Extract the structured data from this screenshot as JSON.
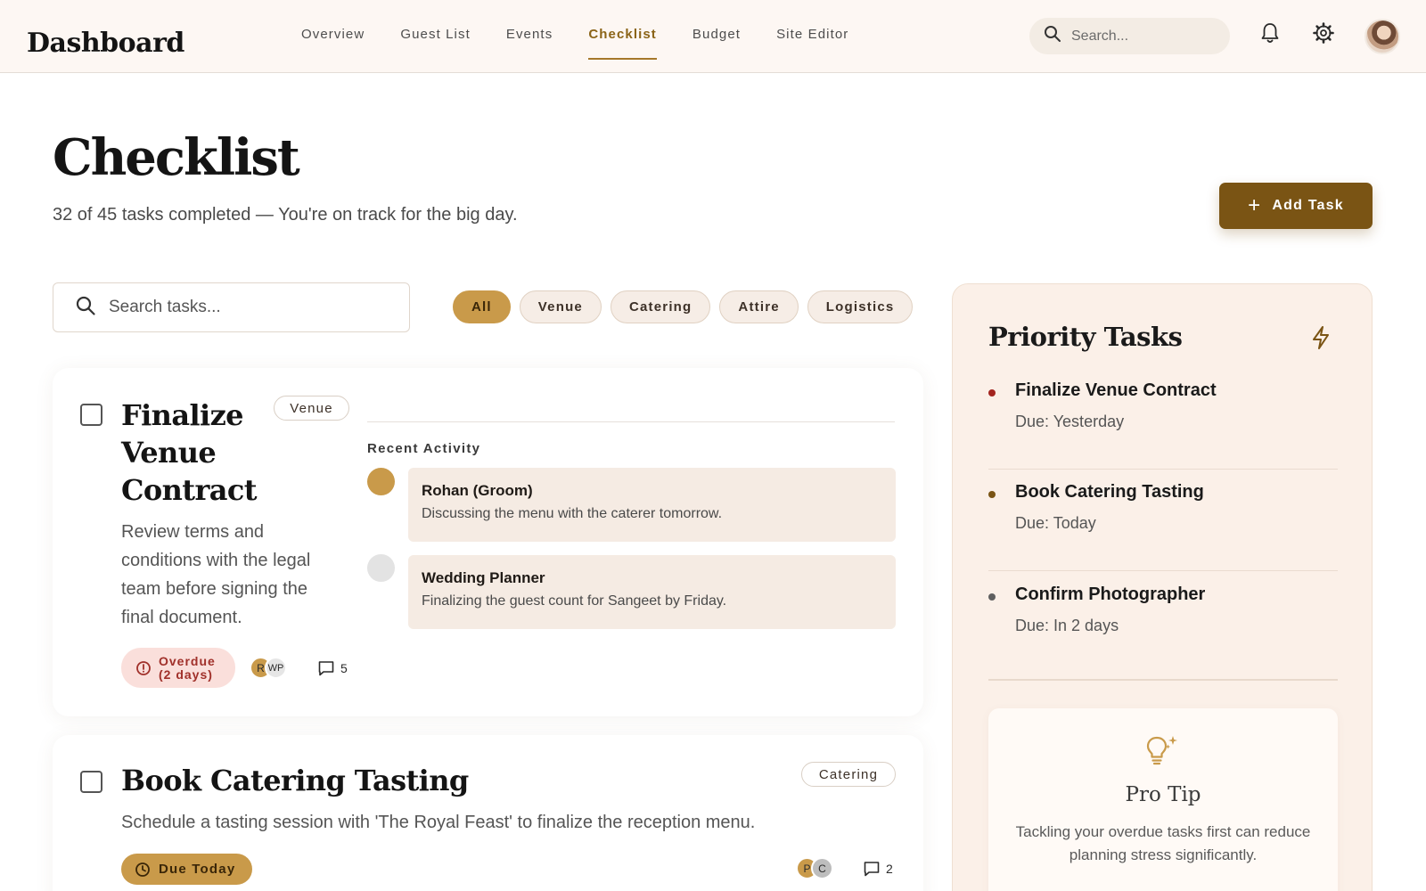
{
  "header": {
    "brand": "Dashboard",
    "nav": [
      "Overview",
      "Guest List",
      "Events",
      "Checklist",
      "Budget",
      "Site Editor"
    ],
    "active_nav": "Checklist",
    "search_placeholder": "Search..."
  },
  "page": {
    "title": "Checklist",
    "subtitle": "32 of 45 tasks completed — You're on track for the big day.",
    "add_task_label": "Add Task"
  },
  "filters": {
    "search_placeholder": "Search tasks...",
    "chips": [
      "All",
      "Venue",
      "Catering",
      "Attire",
      "Logistics"
    ],
    "active_chip": "All"
  },
  "tasks": [
    {
      "title": "Finalize Venue Contract",
      "category": "Venue",
      "description": "Review terms and conditions with the legal team before signing the final document.",
      "status_line1": "Overdue",
      "status_line2": "(2 days)",
      "assignees": [
        "R",
        "WP"
      ],
      "comments": "5",
      "activity_heading": "Recent Activity",
      "activity": [
        {
          "name": "Rohan (Groom)",
          "text": "Discussing the menu with the caterer tomorrow."
        },
        {
          "name": "Wedding Planner",
          "text": "Finalizing the guest count for Sangeet by Friday."
        }
      ]
    },
    {
      "title": "Book Catering Tasting",
      "category": "Catering",
      "description": "Schedule a tasting session with 'The Royal Feast' to finalize the reception menu.",
      "status": "Due Today",
      "assignees": [
        "P",
        "C"
      ],
      "comments": "2"
    }
  ],
  "priority_panel": {
    "title": "Priority Tasks",
    "items": [
      {
        "name": "Finalize Venue Contract",
        "due": "Due: Yesterday",
        "color": "#a3241f"
      },
      {
        "name": "Book Catering Tasting",
        "due": "Due: Today",
        "color": "#7a5414"
      },
      {
        "name": "Confirm Photographer",
        "due": "Due: In 2 days",
        "color": "#5f5f5f"
      }
    ],
    "tip": {
      "title": "Pro Tip",
      "text": "Tackling your overdue tasks first can reduce planning stress significantly."
    }
  },
  "colors": {
    "accent": "#7a5414",
    "gold": "#c99a4a",
    "panel_bg": "#fbf0e8",
    "overdue_bg": "#fadfdb",
    "overdue_text": "#a0302a"
  },
  "icons": [
    "search-icon",
    "bell-icon",
    "gear-icon",
    "plus-icon",
    "bolt-icon",
    "alert-circle-icon",
    "clock-icon",
    "comment-icon",
    "lightbulb-icon"
  ]
}
